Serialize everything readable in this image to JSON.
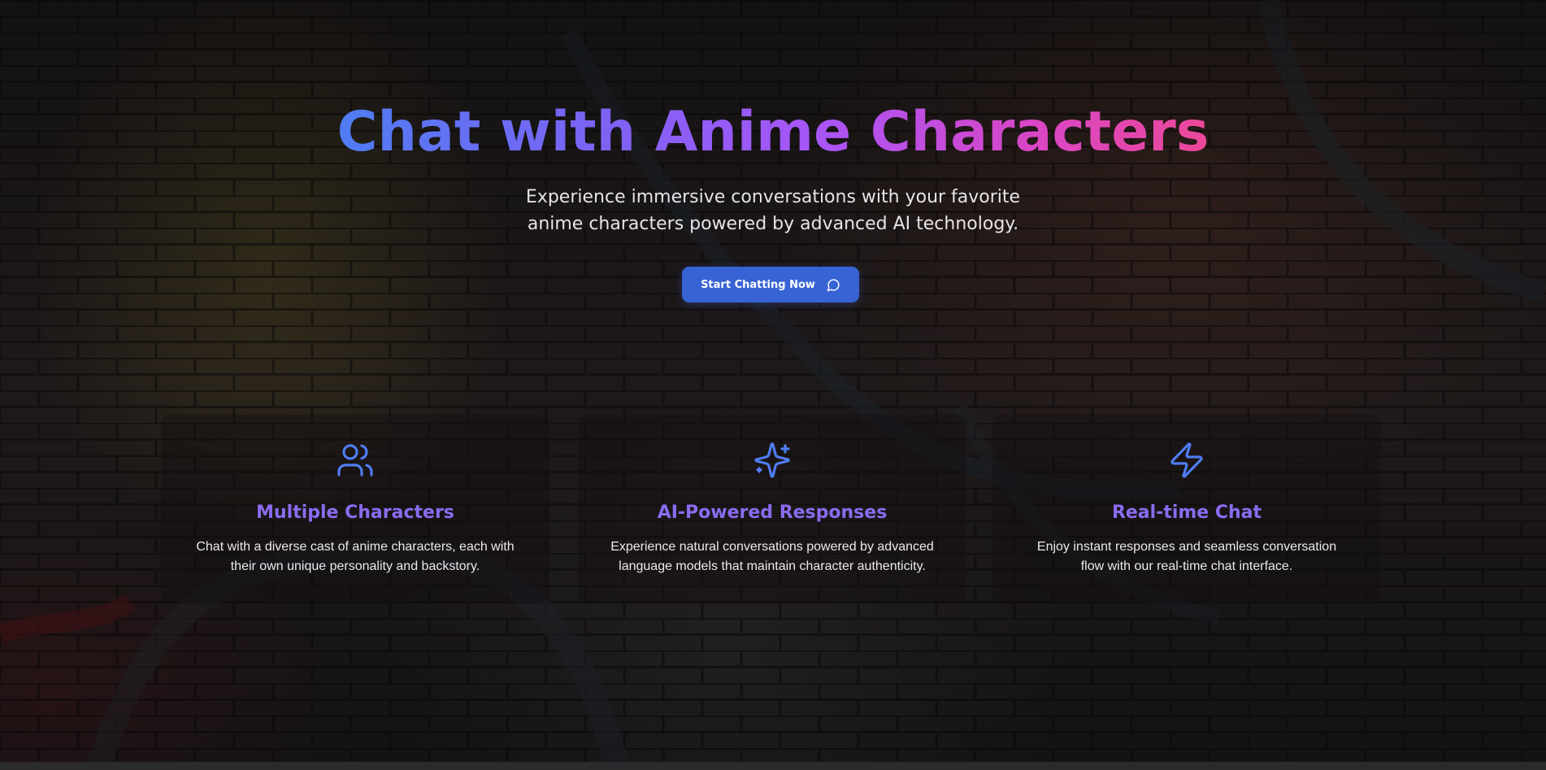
{
  "hero": {
    "title": "Chat with Anime Characters",
    "subtitle": "Experience immersive conversations with your favorite anime characters powered by advanced AI technology.",
    "cta_label": "Start Chatting Now",
    "cta_icon": "message-circle-icon"
  },
  "features": [
    {
      "icon": "users-icon",
      "title": "Multiple Characters",
      "description": "Chat with a diverse cast of anime characters, each with their own unique personality and backstory."
    },
    {
      "icon": "sparkles-icon",
      "title": "AI-Powered Responses",
      "description": "Experience natural conversations powered by advanced language models that maintain character authenticity."
    },
    {
      "icon": "zap-icon",
      "title": "Real-time Chat",
      "description": "Enjoy instant responses and seamless conversation flow with our real-time chat interface."
    }
  ],
  "colors": {
    "accent_blue": "#3763d4",
    "icon_blue": "#4f7cf2",
    "feature_title": "#8b6bf0",
    "gradient_start": "#4f7cf2",
    "gradient_mid": "#a855f7",
    "gradient_end": "#ec4899"
  }
}
